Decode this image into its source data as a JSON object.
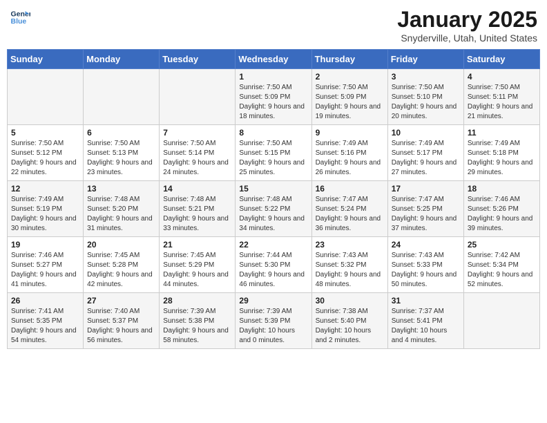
{
  "logo": {
    "line1": "General",
    "line2": "Blue"
  },
  "title": "January 2025",
  "subtitle": "Snyderville, Utah, United States",
  "weekdays": [
    "Sunday",
    "Monday",
    "Tuesday",
    "Wednesday",
    "Thursday",
    "Friday",
    "Saturday"
  ],
  "weeks": [
    [
      {
        "day": "",
        "sunrise": "",
        "sunset": "",
        "daylight": ""
      },
      {
        "day": "",
        "sunrise": "",
        "sunset": "",
        "daylight": ""
      },
      {
        "day": "",
        "sunrise": "",
        "sunset": "",
        "daylight": ""
      },
      {
        "day": "1",
        "sunrise": "Sunrise: 7:50 AM",
        "sunset": "Sunset: 5:09 PM",
        "daylight": "Daylight: 9 hours and 18 minutes."
      },
      {
        "day": "2",
        "sunrise": "Sunrise: 7:50 AM",
        "sunset": "Sunset: 5:09 PM",
        "daylight": "Daylight: 9 hours and 19 minutes."
      },
      {
        "day": "3",
        "sunrise": "Sunrise: 7:50 AM",
        "sunset": "Sunset: 5:10 PM",
        "daylight": "Daylight: 9 hours and 20 minutes."
      },
      {
        "day": "4",
        "sunrise": "Sunrise: 7:50 AM",
        "sunset": "Sunset: 5:11 PM",
        "daylight": "Daylight: 9 hours and 21 minutes."
      }
    ],
    [
      {
        "day": "5",
        "sunrise": "Sunrise: 7:50 AM",
        "sunset": "Sunset: 5:12 PM",
        "daylight": "Daylight: 9 hours and 22 minutes."
      },
      {
        "day": "6",
        "sunrise": "Sunrise: 7:50 AM",
        "sunset": "Sunset: 5:13 PM",
        "daylight": "Daylight: 9 hours and 23 minutes."
      },
      {
        "day": "7",
        "sunrise": "Sunrise: 7:50 AM",
        "sunset": "Sunset: 5:14 PM",
        "daylight": "Daylight: 9 hours and 24 minutes."
      },
      {
        "day": "8",
        "sunrise": "Sunrise: 7:50 AM",
        "sunset": "Sunset: 5:15 PM",
        "daylight": "Daylight: 9 hours and 25 minutes."
      },
      {
        "day": "9",
        "sunrise": "Sunrise: 7:49 AM",
        "sunset": "Sunset: 5:16 PM",
        "daylight": "Daylight: 9 hours and 26 minutes."
      },
      {
        "day": "10",
        "sunrise": "Sunrise: 7:49 AM",
        "sunset": "Sunset: 5:17 PM",
        "daylight": "Daylight: 9 hours and 27 minutes."
      },
      {
        "day": "11",
        "sunrise": "Sunrise: 7:49 AM",
        "sunset": "Sunset: 5:18 PM",
        "daylight": "Daylight: 9 hours and 29 minutes."
      }
    ],
    [
      {
        "day": "12",
        "sunrise": "Sunrise: 7:49 AM",
        "sunset": "Sunset: 5:19 PM",
        "daylight": "Daylight: 9 hours and 30 minutes."
      },
      {
        "day": "13",
        "sunrise": "Sunrise: 7:48 AM",
        "sunset": "Sunset: 5:20 PM",
        "daylight": "Daylight: 9 hours and 31 minutes."
      },
      {
        "day": "14",
        "sunrise": "Sunrise: 7:48 AM",
        "sunset": "Sunset: 5:21 PM",
        "daylight": "Daylight: 9 hours and 33 minutes."
      },
      {
        "day": "15",
        "sunrise": "Sunrise: 7:48 AM",
        "sunset": "Sunset: 5:22 PM",
        "daylight": "Daylight: 9 hours and 34 minutes."
      },
      {
        "day": "16",
        "sunrise": "Sunrise: 7:47 AM",
        "sunset": "Sunset: 5:24 PM",
        "daylight": "Daylight: 9 hours and 36 minutes."
      },
      {
        "day": "17",
        "sunrise": "Sunrise: 7:47 AM",
        "sunset": "Sunset: 5:25 PM",
        "daylight": "Daylight: 9 hours and 37 minutes."
      },
      {
        "day": "18",
        "sunrise": "Sunrise: 7:46 AM",
        "sunset": "Sunset: 5:26 PM",
        "daylight": "Daylight: 9 hours and 39 minutes."
      }
    ],
    [
      {
        "day": "19",
        "sunrise": "Sunrise: 7:46 AM",
        "sunset": "Sunset: 5:27 PM",
        "daylight": "Daylight: 9 hours and 41 minutes."
      },
      {
        "day": "20",
        "sunrise": "Sunrise: 7:45 AM",
        "sunset": "Sunset: 5:28 PM",
        "daylight": "Daylight: 9 hours and 42 minutes."
      },
      {
        "day": "21",
        "sunrise": "Sunrise: 7:45 AM",
        "sunset": "Sunset: 5:29 PM",
        "daylight": "Daylight: 9 hours and 44 minutes."
      },
      {
        "day": "22",
        "sunrise": "Sunrise: 7:44 AM",
        "sunset": "Sunset: 5:30 PM",
        "daylight": "Daylight: 9 hours and 46 minutes."
      },
      {
        "day": "23",
        "sunrise": "Sunrise: 7:43 AM",
        "sunset": "Sunset: 5:32 PM",
        "daylight": "Daylight: 9 hours and 48 minutes."
      },
      {
        "day": "24",
        "sunrise": "Sunrise: 7:43 AM",
        "sunset": "Sunset: 5:33 PM",
        "daylight": "Daylight: 9 hours and 50 minutes."
      },
      {
        "day": "25",
        "sunrise": "Sunrise: 7:42 AM",
        "sunset": "Sunset: 5:34 PM",
        "daylight": "Daylight: 9 hours and 52 minutes."
      }
    ],
    [
      {
        "day": "26",
        "sunrise": "Sunrise: 7:41 AM",
        "sunset": "Sunset: 5:35 PM",
        "daylight": "Daylight: 9 hours and 54 minutes."
      },
      {
        "day": "27",
        "sunrise": "Sunrise: 7:40 AM",
        "sunset": "Sunset: 5:37 PM",
        "daylight": "Daylight: 9 hours and 56 minutes."
      },
      {
        "day": "28",
        "sunrise": "Sunrise: 7:39 AM",
        "sunset": "Sunset: 5:38 PM",
        "daylight": "Daylight: 9 hours and 58 minutes."
      },
      {
        "day": "29",
        "sunrise": "Sunrise: 7:39 AM",
        "sunset": "Sunset: 5:39 PM",
        "daylight": "Daylight: 10 hours and 0 minutes."
      },
      {
        "day": "30",
        "sunrise": "Sunrise: 7:38 AM",
        "sunset": "Sunset: 5:40 PM",
        "daylight": "Daylight: 10 hours and 2 minutes."
      },
      {
        "day": "31",
        "sunrise": "Sunrise: 7:37 AM",
        "sunset": "Sunset: 5:41 PM",
        "daylight": "Daylight: 10 hours and 4 minutes."
      },
      {
        "day": "",
        "sunrise": "",
        "sunset": "",
        "daylight": ""
      }
    ]
  ]
}
